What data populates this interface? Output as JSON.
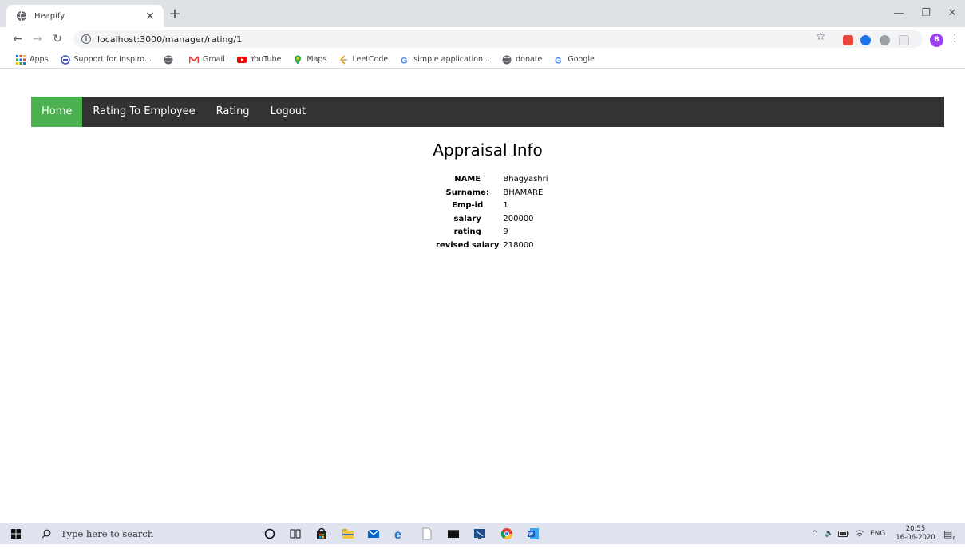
{
  "browser": {
    "tab_title": "Heapify",
    "tab_close": "×",
    "new_tab": "+",
    "url": "localhost:3000/manager/rating/1",
    "profile_initial": "B",
    "window_controls": {
      "minimize": "—",
      "restore": "❐",
      "close": "✕"
    }
  },
  "bookmarks": [
    {
      "label": "Apps",
      "icon": "apps-grid-icon"
    },
    {
      "label": "Support for Inspiro...",
      "icon": "support-icon"
    },
    {
      "label": "",
      "icon": "globe-icon"
    },
    {
      "label": "Gmail",
      "icon": "gmail-icon"
    },
    {
      "label": "YouTube",
      "icon": "youtube-icon"
    },
    {
      "label": "Maps",
      "icon": "maps-icon"
    },
    {
      "label": "LeetCode",
      "icon": "leetcode-icon"
    },
    {
      "label": "simple application...",
      "icon": "google-icon"
    },
    {
      "label": "donate",
      "icon": "globe-icon"
    },
    {
      "label": "Google",
      "icon": "google-icon"
    }
  ],
  "nav": {
    "home": "Home",
    "rating_to_employee": "Rating To Employee",
    "rating": "Rating",
    "logout": "Logout",
    "active_color": "#4caf50",
    "bar_color": "#333333"
  },
  "appraisal": {
    "title": "Appraisal Info",
    "rows": [
      {
        "label": "NAME",
        "value": "Bhagyashri"
      },
      {
        "label": "Surname:",
        "value": "BHAMARE"
      },
      {
        "label": "Emp-id",
        "value": "1"
      },
      {
        "label": "salary",
        "value": "200000"
      },
      {
        "label": "rating",
        "value": "9"
      },
      {
        "label": "revised salary",
        "value": "218000"
      }
    ]
  },
  "taskbar": {
    "search_placeholder": "Type here to search",
    "language": "ENG",
    "time": "20:55",
    "date": "16-06-2020",
    "notification_count": "6"
  }
}
